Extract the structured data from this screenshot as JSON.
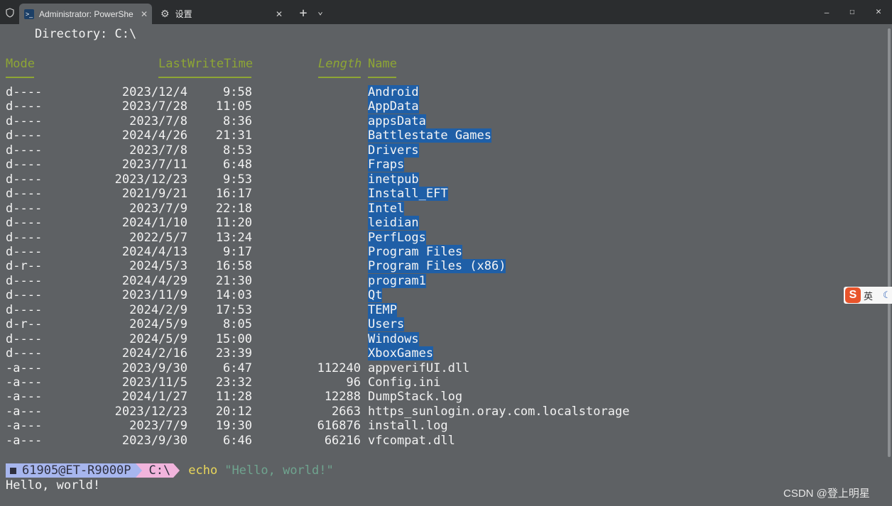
{
  "window": {
    "tabs": [
      {
        "label": "Administrator: PowerShe",
        "icon": "powershell-icon"
      },
      {
        "label": "设置",
        "icon": "gear-icon"
      }
    ],
    "shield_icon": "shield-icon",
    "new_tab_symbol": "+",
    "dropdown_symbol": "⌄",
    "minimize_symbol": "—",
    "maximize_symbol": "☐",
    "close_symbol": "✕"
  },
  "terminal": {
    "directory_line": "    Directory: C:\\",
    "headers": {
      "mode": "Mode",
      "lastwritetime": "LastWriteTime",
      "length": "Length",
      "name": "Name"
    },
    "entries": [
      {
        "mode": "d----",
        "date": "2023/12/4",
        "time": "9:58",
        "length": "",
        "name": "Android",
        "dir": true
      },
      {
        "mode": "d----",
        "date": "2023/7/28",
        "time": "11:05",
        "length": "",
        "name": "AppData",
        "dir": true
      },
      {
        "mode": "d----",
        "date": "2023/7/8",
        "time": "8:36",
        "length": "",
        "name": "appsData",
        "dir": true
      },
      {
        "mode": "d----",
        "date": "2024/4/26",
        "time": "21:31",
        "length": "",
        "name": "Battlestate Games",
        "dir": true
      },
      {
        "mode": "d----",
        "date": "2023/7/8",
        "time": "8:53",
        "length": "",
        "name": "Drivers",
        "dir": true
      },
      {
        "mode": "d----",
        "date": "2023/7/11",
        "time": "6:48",
        "length": "",
        "name": "Fraps",
        "dir": true
      },
      {
        "mode": "d----",
        "date": "2023/12/23",
        "time": "9:53",
        "length": "",
        "name": "inetpub",
        "dir": true
      },
      {
        "mode": "d----",
        "date": "2021/9/21",
        "time": "16:17",
        "length": "",
        "name": "Install_EFT",
        "dir": true
      },
      {
        "mode": "d----",
        "date": "2023/7/9",
        "time": "22:18",
        "length": "",
        "name": "Intel",
        "dir": true
      },
      {
        "mode": "d----",
        "date": "2024/1/10",
        "time": "11:20",
        "length": "",
        "name": "leidian",
        "dir": true
      },
      {
        "mode": "d----",
        "date": "2022/5/7",
        "time": "13:24",
        "length": "",
        "name": "PerfLogs",
        "dir": true
      },
      {
        "mode": "d----",
        "date": "2024/4/13",
        "time": "9:17",
        "length": "",
        "name": "Program Files",
        "dir": true
      },
      {
        "mode": "d-r--",
        "date": "2024/5/3",
        "time": "16:58",
        "length": "",
        "name": "Program Files (x86)",
        "dir": true
      },
      {
        "mode": "d----",
        "date": "2024/4/29",
        "time": "21:30",
        "length": "",
        "name": "program1",
        "dir": true
      },
      {
        "mode": "d----",
        "date": "2023/11/9",
        "time": "14:03",
        "length": "",
        "name": "Qt",
        "dir": true
      },
      {
        "mode": "d----",
        "date": "2024/2/9",
        "time": "17:53",
        "length": "",
        "name": "TEMP",
        "dir": true
      },
      {
        "mode": "d-r--",
        "date": "2024/5/9",
        "time": "8:05",
        "length": "",
        "name": "Users",
        "dir": true
      },
      {
        "mode": "d----",
        "date": "2024/5/9",
        "time": "15:00",
        "length": "",
        "name": "Windows",
        "dir": true
      },
      {
        "mode": "d----",
        "date": "2024/2/16",
        "time": "23:39",
        "length": "",
        "name": "XboxGames",
        "dir": true
      },
      {
        "mode": "-a---",
        "date": "2023/9/30",
        "time": "6:47",
        "length": "112240",
        "name": "appverifUI.dll",
        "dir": false
      },
      {
        "mode": "-a---",
        "date": "2023/11/5",
        "time": "23:32",
        "length": "96",
        "name": "Config.ini",
        "dir": false
      },
      {
        "mode": "-a---",
        "date": "2024/1/27",
        "time": "11:28",
        "length": "12288",
        "name": "DumpStack.log",
        "dir": false
      },
      {
        "mode": "-a---",
        "date": "2023/12/23",
        "time": "20:12",
        "length": "2663",
        "name": "https_sunlogin.oray.com.localstorage",
        "dir": false
      },
      {
        "mode": "-a---",
        "date": "2023/7/9",
        "time": "19:30",
        "length": "616876",
        "name": "install.log",
        "dir": false
      },
      {
        "mode": "-a---",
        "date": "2023/9/30",
        "time": "6:46",
        "length": "66216",
        "name": "vfcompat.dll",
        "dir": false
      }
    ],
    "prompt": {
      "user": "61905@ET-R9000P",
      "path": "C:\\",
      "command": "echo",
      "argument": "\"Hello, world!\""
    },
    "output": "Hello, world!"
  },
  "ime": {
    "label": "英",
    "logo": "S"
  },
  "watermark": "CSDN @登上明星",
  "colors": {
    "header": "#8ea634",
    "dir_highlight": "#1f5fa7",
    "background": "#5e6164"
  }
}
